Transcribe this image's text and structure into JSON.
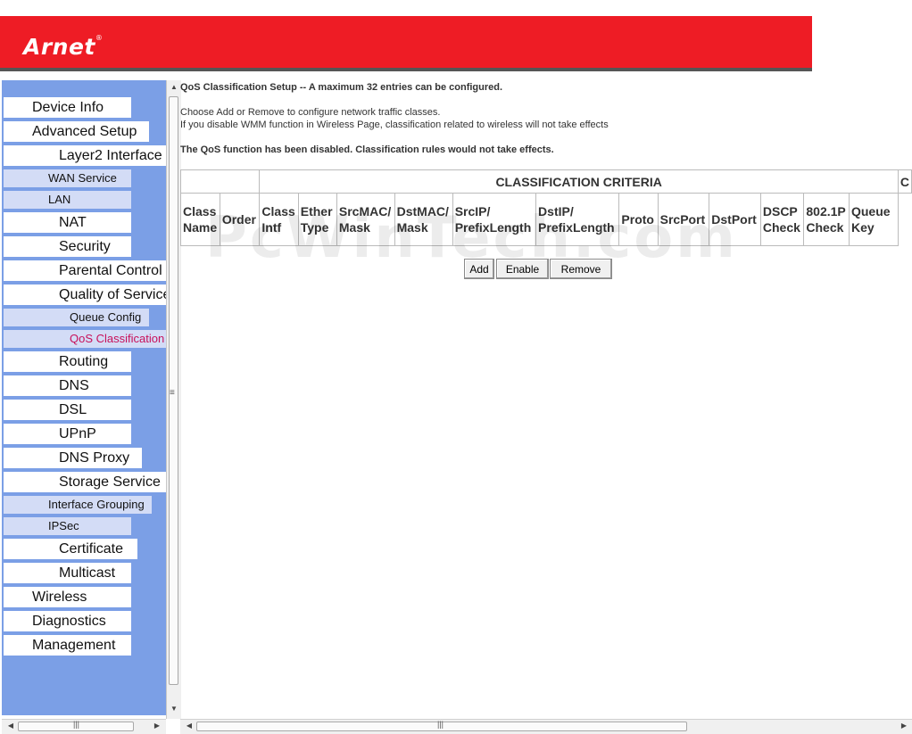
{
  "brand": {
    "logo_text": "Arnet",
    "logo_mark": "®"
  },
  "sidebar": {
    "items": [
      {
        "label": "Device Info"
      },
      {
        "label": "Advanced Setup"
      },
      {
        "label": "Layer2 Interface"
      },
      {
        "label": "WAN Service"
      },
      {
        "label": "LAN"
      },
      {
        "label": "NAT"
      },
      {
        "label": "Security"
      },
      {
        "label": "Parental Control"
      },
      {
        "label": "Quality of Service"
      },
      {
        "label": "Queue Config"
      },
      {
        "label": "QoS Classification"
      },
      {
        "label": "Routing"
      },
      {
        "label": "DNS"
      },
      {
        "label": "DSL"
      },
      {
        "label": "UPnP"
      },
      {
        "label": "DNS Proxy"
      },
      {
        "label": "Storage Service"
      },
      {
        "label": "Interface Grouping"
      },
      {
        "label": "IPSec"
      },
      {
        "label": "Certificate"
      },
      {
        "label": "Multicast"
      },
      {
        "label": "Wireless"
      },
      {
        "label": "Diagnostics"
      },
      {
        "label": "Management"
      }
    ]
  },
  "main": {
    "title": "QoS Classification Setup -- A maximum 32 entries can be configured.",
    "info_line1": "Choose Add or Remove to configure network traffic classes.",
    "info_line2": "If you disable WMM function in Wireless Page, classification related to wireless will not take effects",
    "warning": "The QoS function has been disabled. Classification rules would not take effects.",
    "watermark": "PcWinTech.com",
    "table": {
      "group_header": "CLASSIFICATION CRITERIA",
      "group_header_right": "C",
      "columns": [
        "Class Name",
        "Order",
        "Class Intf",
        "Ether Type",
        "SrcMAC/ Mask",
        "DstMAC/ Mask",
        "SrcIP/ PrefixLength",
        "DstIP/ PrefixLength",
        "Proto",
        "SrcPort",
        "DstPort",
        "DSCP Check",
        "802.1P Check",
        "Queue Key"
      ]
    },
    "buttons": {
      "add": "Add",
      "enable": "Enable",
      "remove": "Remove"
    }
  }
}
